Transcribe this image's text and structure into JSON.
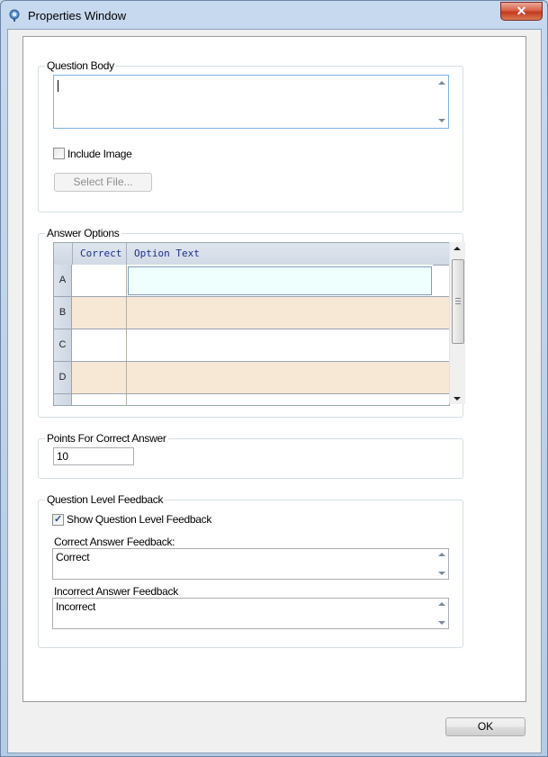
{
  "window": {
    "title": "Properties Window",
    "close_glyph": "✕"
  },
  "question_body": {
    "label": "Question Body",
    "value": ""
  },
  "include_image": {
    "label": "Include Image",
    "checked": false
  },
  "select_file": {
    "label": "Select File..."
  },
  "answer_options": {
    "label": "Answer Options",
    "columns": [
      "Correct",
      "Option Text"
    ],
    "rows": [
      {
        "key": "A",
        "correct": "",
        "text": ""
      },
      {
        "key": "B",
        "correct": "",
        "text": ""
      },
      {
        "key": "C",
        "correct": "",
        "text": ""
      },
      {
        "key": "D",
        "correct": "",
        "text": ""
      }
    ],
    "colors": {
      "row_alt": "#f7e7d5",
      "row": "#ffffff",
      "selected_cell": "#effffd"
    }
  },
  "points": {
    "label": "Points For Correct Answer",
    "value": "10"
  },
  "feedback": {
    "label": "Question Level Feedback",
    "show_label": "Show Question Level Feedback",
    "show_checked": true,
    "correct_label": "Correct Answer Feedback:",
    "correct_value": "Correct",
    "incorrect_label": "Incorrect Answer Feedback",
    "incorrect_value": "Incorrect"
  },
  "ok_button": {
    "label": "OK"
  },
  "icons": {
    "app": "properties-icon",
    "check": "✓"
  }
}
